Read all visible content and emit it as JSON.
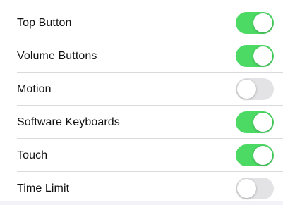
{
  "settings": {
    "rows": [
      {
        "label": "Top Button",
        "enabled": true
      },
      {
        "label": "Volume Buttons",
        "enabled": true
      },
      {
        "label": "Motion",
        "enabled": false
      },
      {
        "label": "Software Keyboards",
        "enabled": true
      },
      {
        "label": "Touch",
        "enabled": true
      },
      {
        "label": "Time Limit",
        "enabled": false
      }
    ]
  },
  "colors": {
    "toggle_on": "#4cd964",
    "toggle_off": "#e3e3e6",
    "text": "#111111",
    "background": "#ffffff"
  }
}
